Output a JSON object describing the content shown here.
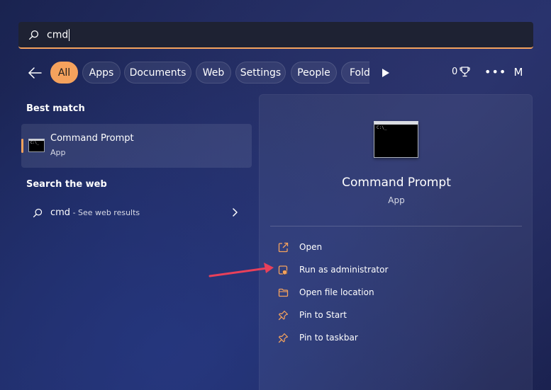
{
  "search": {
    "value": "cmd"
  },
  "filters": {
    "tabs": [
      "All",
      "Apps",
      "Documents",
      "Web",
      "Settings",
      "People",
      "Folde"
    ],
    "rewards_count": "0",
    "more_label": "•••",
    "avatar_initial": "M"
  },
  "best_match": {
    "heading": "Best match",
    "title": "Command Prompt",
    "subtitle": "App"
  },
  "search_web": {
    "heading": "Search the web",
    "query": "cmd",
    "suffix": " - See web results"
  },
  "detail": {
    "icon_text": "C:\\_",
    "title": "Command Prompt",
    "subtitle": "App",
    "actions": [
      {
        "label": "Open",
        "icon": "open-external-icon"
      },
      {
        "label": "Run as administrator",
        "icon": "shield-admin-icon"
      },
      {
        "label": "Open file location",
        "icon": "folder-icon"
      },
      {
        "label": "Pin to Start",
        "icon": "pin-icon"
      },
      {
        "label": "Pin to taskbar",
        "icon": "pin-icon"
      }
    ]
  },
  "colors": {
    "accent": "#f5a25d",
    "annotation_arrow": "#e8405a"
  }
}
